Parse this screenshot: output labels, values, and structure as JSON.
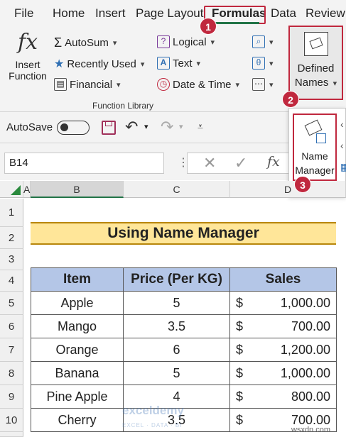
{
  "menu": {
    "tabs": [
      "File",
      "Home",
      "Insert",
      "Page Layout",
      "Formulas",
      "Data",
      "Review"
    ],
    "active": "Formulas"
  },
  "badges": [
    "1",
    "2",
    "3"
  ],
  "ribbon": {
    "insert_function": {
      "line1": "Insert",
      "line2": "Function"
    },
    "col1": [
      "AutoSum",
      "Recently Used",
      "Financial"
    ],
    "col2": [
      "Logical",
      "Text",
      "Date & Time"
    ],
    "defined_names": {
      "line1": "Defined",
      "line2": "Names"
    },
    "group_label": "Function Library"
  },
  "qat": {
    "autosave_label": "AutoSave"
  },
  "dropdown": {
    "line1": "Name",
    "line2": "Manager"
  },
  "formula_bar": {
    "name_box": "B14",
    "fx": "fx"
  },
  "sheet": {
    "columns": [
      "A",
      "B",
      "C",
      "D"
    ],
    "rows": [
      "1",
      "2",
      "3",
      "4",
      "5",
      "6",
      "7",
      "8",
      "9",
      "10"
    ],
    "title": "Using Name Manager",
    "headers": [
      "Item",
      "Price  (Per KG)",
      "Sales"
    ],
    "currency": "$",
    "data": [
      {
        "item": "Apple",
        "price": "5",
        "sales": "1,000.00"
      },
      {
        "item": "Mango",
        "price": "3.5",
        "sales": "700.00"
      },
      {
        "item": "Orange",
        "price": "6",
        "sales": "1,200.00"
      },
      {
        "item": "Banana",
        "price": "5",
        "sales": "1,000.00"
      },
      {
        "item": "Pine Apple",
        "price": "4",
        "sales": "800.00"
      },
      {
        "item": "Cherry",
        "price": "3.5",
        "sales": "700.00"
      }
    ]
  },
  "watermark": {
    "brand": "exceldemy",
    "tagline": "EXCEL · DATA · BI"
  },
  "footer": {
    "site": "wsxdn.com"
  },
  "colors": {
    "accent_red": "#c0283e",
    "excel_green": "#217346",
    "title_fill": "#ffe699",
    "header_fill": "#b4c6e7"
  }
}
